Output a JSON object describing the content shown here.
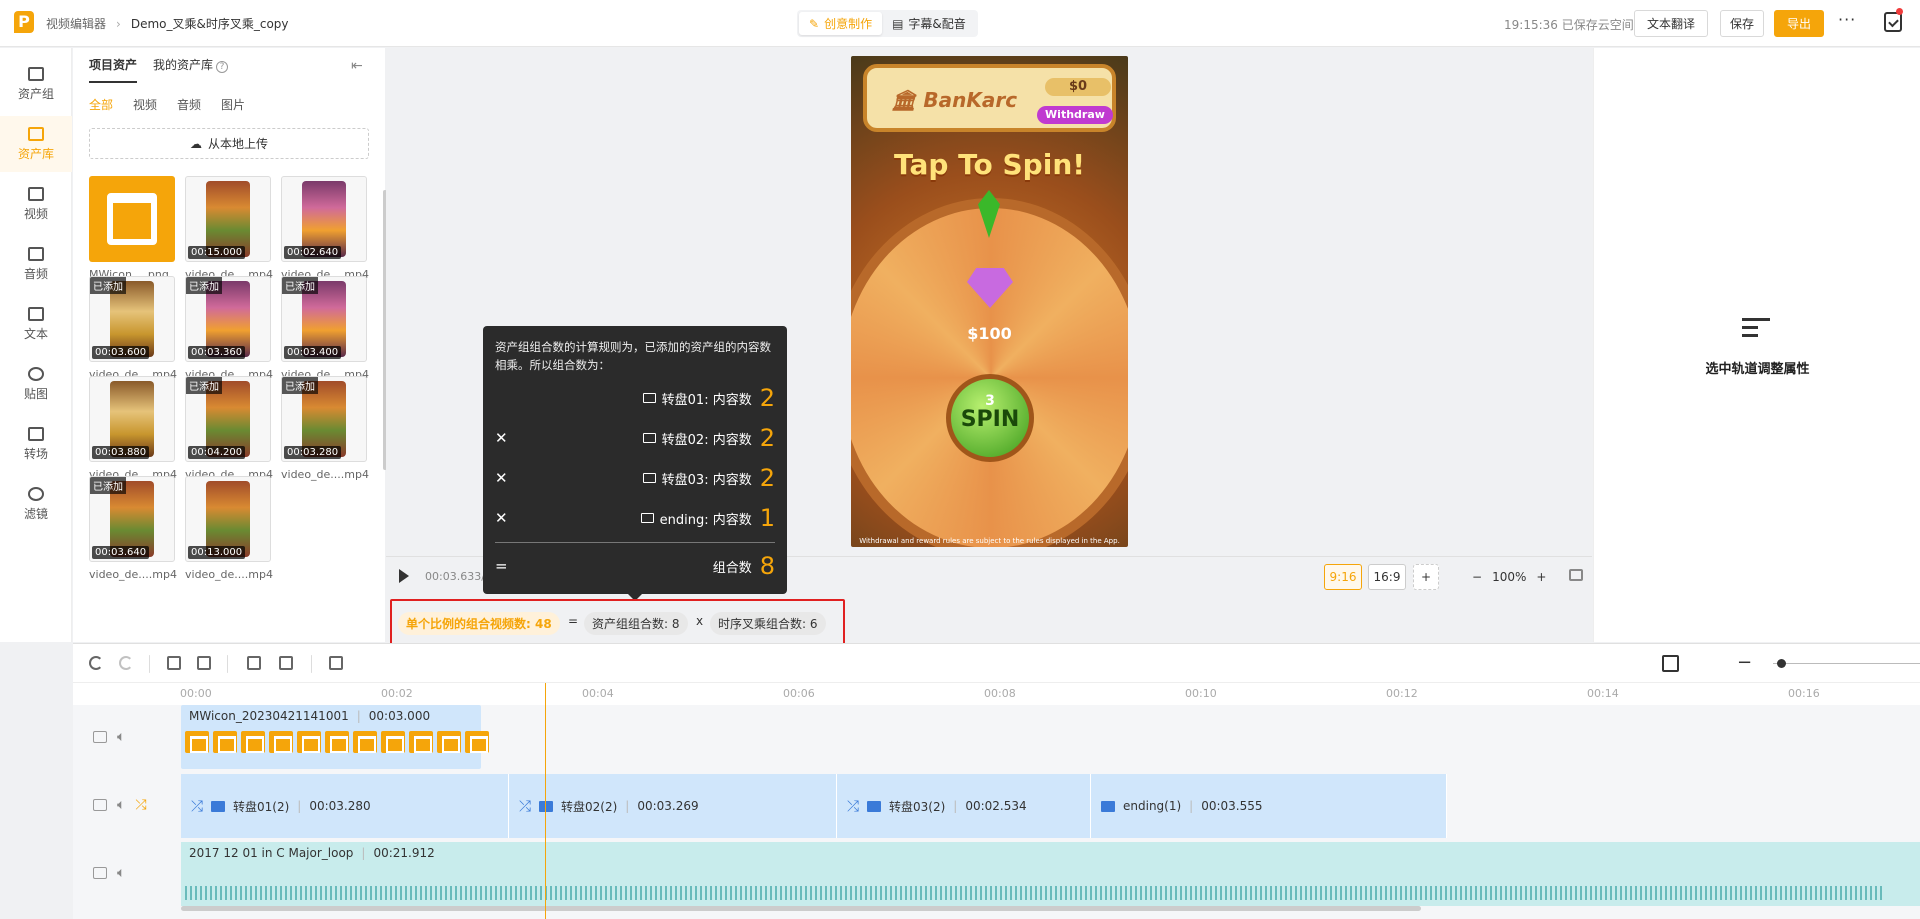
{
  "header": {
    "logo": "P",
    "breadcrumb_root": "视频编辑器",
    "project_title": "Demo_叉乘&时序叉乘_copy",
    "modes": [
      "创意制作",
      "字幕&配音"
    ],
    "save_status": "19:15:36 已保存云空间",
    "translate_label": "文本翻译",
    "save_label": "保存",
    "export_label": "导出",
    "more_label": "···"
  },
  "sidebar": {
    "items": [
      {
        "label": "资产组",
        "icon": "folder-icon"
      },
      {
        "label": "资产库",
        "icon": "library-icon"
      },
      {
        "label": "视频",
        "icon": "film-icon"
      },
      {
        "label": "音频",
        "icon": "music-icon"
      },
      {
        "label": "文本",
        "icon": "text-icon"
      },
      {
        "label": "贴图",
        "icon": "sticker-icon"
      },
      {
        "label": "转场",
        "icon": "transition-icon"
      },
      {
        "label": "滤镜",
        "icon": "filter-icon"
      }
    ],
    "active": "资产库"
  },
  "assets": {
    "tabs": [
      "项目资产",
      "我的资产库"
    ],
    "filters": [
      "全部",
      "视频",
      "音频",
      "图片"
    ],
    "upload_label": "从本地上传",
    "items": [
      {
        "name": "MWicon_...png",
        "duration": "",
        "added": ""
      },
      {
        "name": "video_de....mp4",
        "duration": "00:15.000",
        "added": ""
      },
      {
        "name": "video_de....mp4",
        "duration": "00:02.640",
        "added": ""
      },
      {
        "name": "video_de....mp4",
        "duration": "00:03.600",
        "added": "已添加"
      },
      {
        "name": "video_de....mp4",
        "duration": "00:03.360",
        "added": "已添加"
      },
      {
        "name": "video_de....mp4",
        "duration": "00:03.400",
        "added": "已添加"
      },
      {
        "name": "video_de....mp4",
        "duration": "00:03.880",
        "added": ""
      },
      {
        "name": "video_de....mp4",
        "duration": "00:04.200",
        "added": "已添加"
      },
      {
        "name": "video_de....mp4",
        "duration": "00:03.280",
        "added": "已添加"
      },
      {
        "name": "video_de....mp4",
        "duration": "00:03.640",
        "added": "已添加"
      },
      {
        "name": "video_de....mp4",
        "duration": "00:13.000",
        "added": ""
      }
    ]
  },
  "preview": {
    "bank_name": "BanKarc",
    "balance": "$0",
    "withdraw": "Withdraw",
    "headline": "Tap To Spin!",
    "prize": "$100",
    "spin_count": "3",
    "spin_label": "SPIN",
    "footnote": "Withdrawal and reward rules are subject to the rules displayed in the App.",
    "timecode": "00:03.633/",
    "ratios": [
      "9:16",
      "16:9",
      "+"
    ],
    "zoom": "100%"
  },
  "properties": {
    "hint": "选中轨道调整属性"
  },
  "tooltip": {
    "description": "资产组组合数的计算规则为，已添加的资产组的内容数相乘。所以组合数为：",
    "rows": [
      {
        "op": "",
        "label": "转盘01: 内容数",
        "value": "2"
      },
      {
        "op": "✕",
        "label": "转盘02: 内容数",
        "value": "2"
      },
      {
        "op": "✕",
        "label": "转盘03: 内容数",
        "value": "2"
      },
      {
        "op": "✕",
        "label": "ending: 内容数",
        "value": "1"
      }
    ],
    "total_op": "=",
    "total_label": "组合数",
    "total_value": "8"
  },
  "formula": {
    "main": "单个比例的组合视频数: 48",
    "eq": "=",
    "asset_combo": "资产组组合数: 8",
    "times": "x",
    "seq_combo": "时序叉乘组合数: 6"
  },
  "timeline": {
    "ticks": [
      "00:00",
      "00:02",
      "00:04",
      "00:06",
      "00:08",
      "00:10",
      "00:12",
      "00:14",
      "00:16"
    ],
    "track1": {
      "name": "MWicon_20230421141001",
      "duration": "00:03.000"
    },
    "track2": [
      {
        "name": "转盘01(2)",
        "duration": "00:03.280",
        "shuffle": true
      },
      {
        "name": "转盘02(2)",
        "duration": "00:03.269",
        "shuffle": true
      },
      {
        "name": "转盘03(2)",
        "duration": "00:02.534",
        "shuffle": true
      },
      {
        "name": "ending(1)",
        "duration": "00:03.555",
        "shuffle": false
      }
    ],
    "track3": {
      "name": "2017 12 01 in C Major_loop",
      "duration": "00:21.912"
    }
  },
  "colors": {
    "accent": "#f5a50a",
    "highlight_border": "#e02020",
    "clip_blue": "#d0e6fb",
    "clip_teal": "#c8ecec"
  }
}
